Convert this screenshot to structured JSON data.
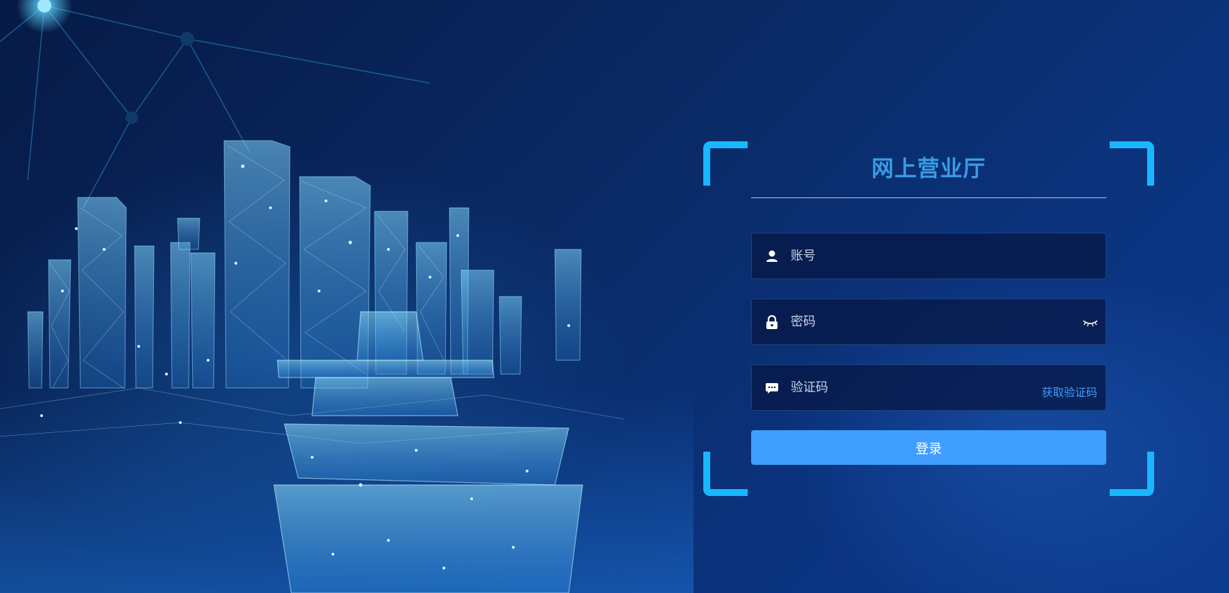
{
  "app": {
    "title": "网上营业厅"
  },
  "form": {
    "account": {
      "placeholder": "账号",
      "value": ""
    },
    "password": {
      "placeholder": "密码",
      "value": ""
    },
    "captcha": {
      "placeholder": "验证码",
      "value": "",
      "get_code_label": "获取验证码"
    },
    "login_label": "登录"
  },
  "icons": {
    "account": "user-icon",
    "password": "lock-icon",
    "captcha": "message-icon",
    "toggle_password": "eye-closed-icon"
  },
  "colors": {
    "accent": "#409eff",
    "corner_frame": "#19b7ff",
    "title": "#3a9ce4",
    "link": "#3e9bf5"
  }
}
